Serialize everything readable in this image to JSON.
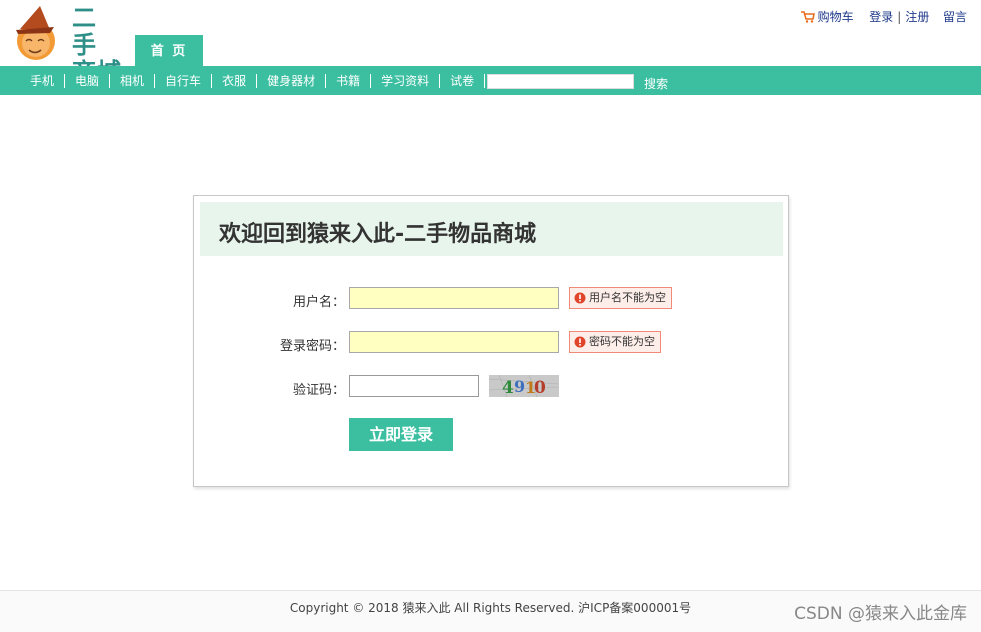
{
  "header": {
    "logo_text": "二手商城",
    "logo_line1": "二 手",
    "logo_line2": "商城",
    "home_tab": "首 页",
    "top_links": {
      "cart": "购物车",
      "login": "登录",
      "register": "注册",
      "message": "留言"
    }
  },
  "nav": {
    "items": [
      "手机",
      "电脑",
      "相机",
      "自行车",
      "衣服",
      "健身器材",
      "书籍",
      "学习资料",
      "试卷"
    ],
    "search_value": "",
    "search_button": "搜索"
  },
  "login": {
    "title": "欢迎回到猿来入此-二手物品商城",
    "username_label": "用户名：",
    "username_value": "",
    "username_error": "用户名不能为空",
    "password_label": "登录密码：",
    "password_value": "",
    "password_error": "密码不能为空",
    "captcha_label": "验证码：",
    "captcha_value": "",
    "captcha_code": "4910",
    "submit": "立即登录"
  },
  "footer": {
    "copyright": "Copyright © 2018 猿来入此 All Rights Reserved. 沪ICP备案000001号"
  },
  "watermark": "CSDN @猿来入此金库",
  "colors": {
    "accent": "#3bbfa0",
    "error_border": "#f08b7a",
    "error_bg": "#fdeee9",
    "input_error_bg": "#ffffc2",
    "title_bg": "#e8f5ec",
    "link": "#1f3a8a"
  }
}
